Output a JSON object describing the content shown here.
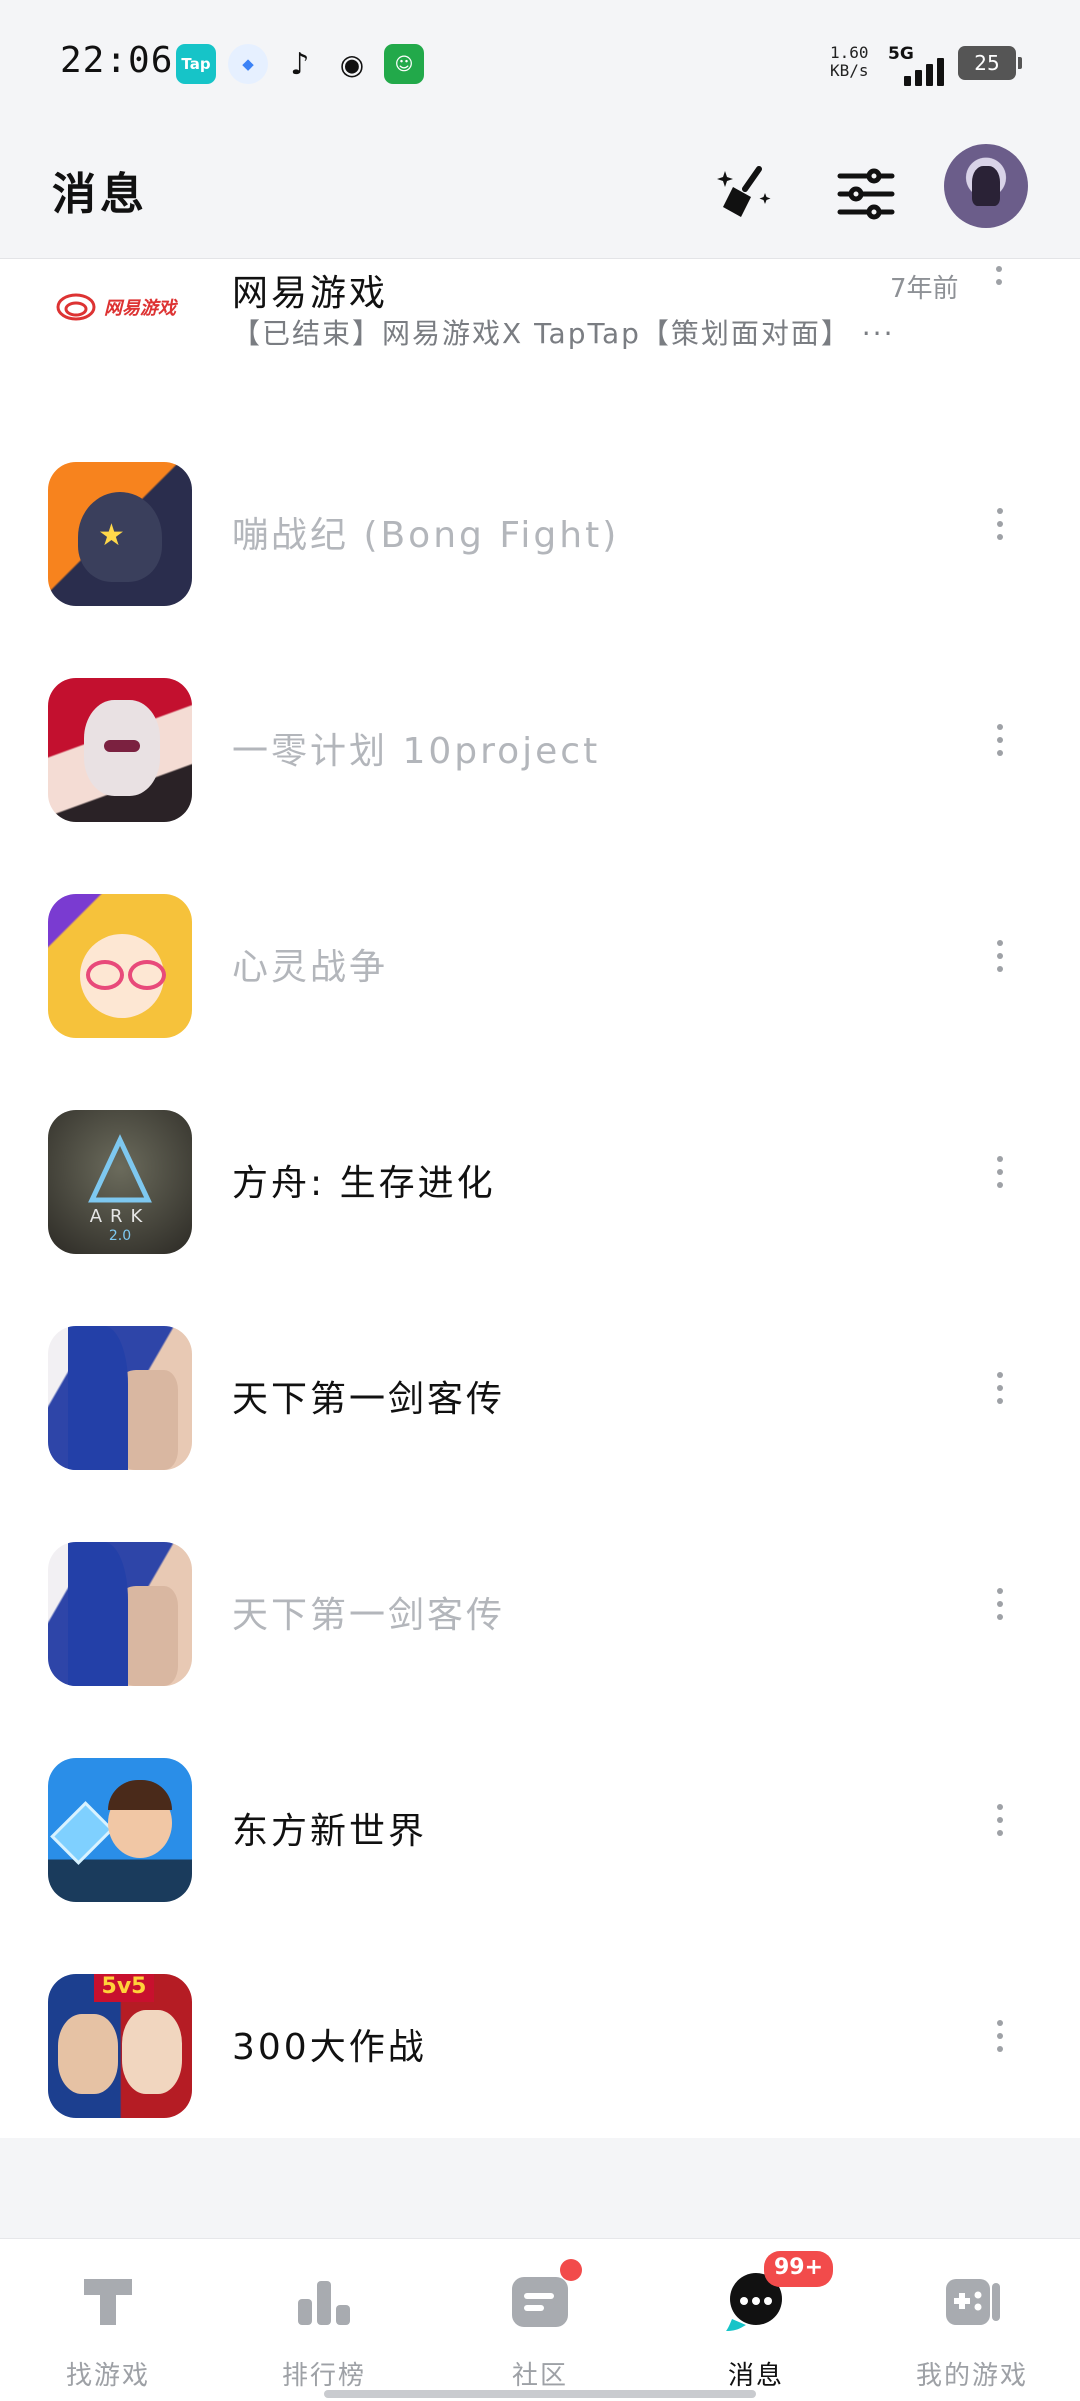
{
  "status": {
    "time": "22:06",
    "net_speed_value": "1.60",
    "net_speed_unit": "KB/s",
    "network": "5G",
    "battery": "25",
    "app_icons": [
      "Tap",
      "blue-app",
      "tiktok",
      "weibo",
      "green-app"
    ]
  },
  "header": {
    "title": "消息"
  },
  "first": {
    "name": "网易游戏",
    "time": "7年前",
    "message": "【已结束】网易游戏X TapTap【策划面对面】 ···",
    "logo_text": "网易游戏"
  },
  "rows": [
    {
      "name": "嘣战纪 (Bong Fight)",
      "dim": true
    },
    {
      "name": "一零计划 10project",
      "dim": true
    },
    {
      "name": "心灵战争",
      "dim": true
    },
    {
      "name": "方舟: 生存进化",
      "dim": false
    },
    {
      "name": "天下第一剑客传",
      "dim": false
    },
    {
      "name": "天下第一剑客传",
      "dim": true
    },
    {
      "name": "东方新世界",
      "dim": false
    },
    {
      "name": "300大作战",
      "dim": false
    }
  ],
  "nav": {
    "items": [
      "找游戏",
      "排行榜",
      "社区",
      "消息",
      "我的游戏"
    ],
    "active": "消息",
    "message_badge": "99+"
  }
}
